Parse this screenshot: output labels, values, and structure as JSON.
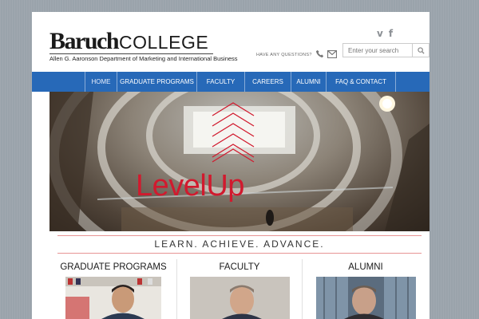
{
  "header": {
    "logo_main": "Baruch",
    "logo_college": "COLLEGE",
    "logo_sub": "Allen G. Aaronson Department of Marketing and International Business",
    "contact_text": "HAVE ANY QUESTIONS?",
    "social": [
      "v",
      "f"
    ],
    "search_placeholder": "Enter your search"
  },
  "nav": {
    "items": [
      "HOME",
      "GRADUATE PROGRAMS",
      "FACULTY",
      "CAREERS",
      "ALUMNI",
      "FAQ & CONTACT"
    ],
    "active_index": 0
  },
  "hero": {
    "title": "LevelUp"
  },
  "tagline": "LEARN. ACHIEVE. ADVANCE.",
  "columns": [
    {
      "title": "GRADUATE PROGRAMS"
    },
    {
      "title": "FACULTY"
    },
    {
      "title": "ALUMNI"
    }
  ],
  "colors": {
    "nav_bg": "#2769b8",
    "accent_red": "#d11a2e",
    "page_bg": "#9aa3ab"
  }
}
